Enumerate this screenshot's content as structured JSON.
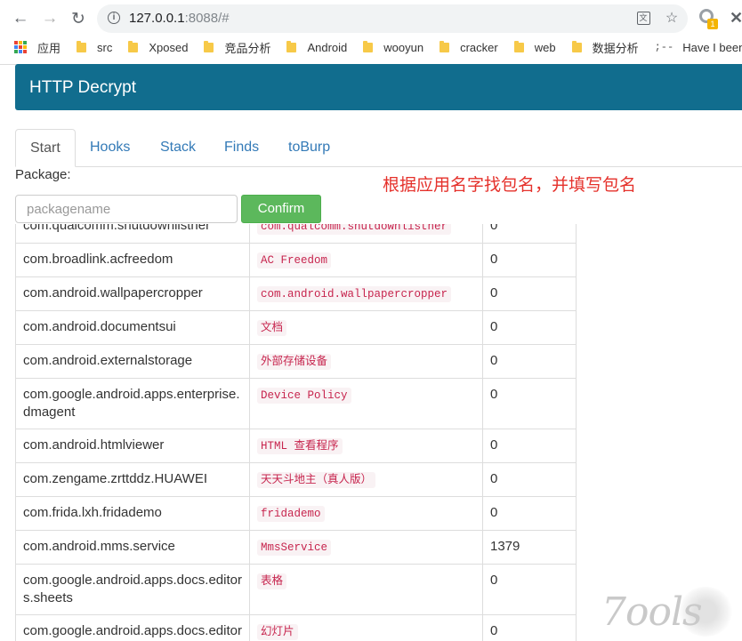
{
  "browser": {
    "url_host": "127.0.0.1",
    "url_rest": ":8088/#",
    "bookmarks": [
      {
        "label": "应用",
        "icon": "apps-grid-icon"
      },
      {
        "label": "src",
        "icon": "folder-icon"
      },
      {
        "label": "Xposed",
        "icon": "folder-icon"
      },
      {
        "label": "竞品分析",
        "icon": "folder-icon"
      },
      {
        "label": "Android",
        "icon": "folder-icon"
      },
      {
        "label": "wooyun",
        "icon": "folder-icon"
      },
      {
        "label": "cracker",
        "icon": "folder-icon"
      },
      {
        "label": "web",
        "icon": "folder-icon"
      },
      {
        "label": "数据分析",
        "icon": "folder-icon"
      },
      {
        "label": "Have I been pwn",
        "icon": "hibp-icon",
        "prefix": ";--"
      }
    ],
    "extension_badge": "1"
  },
  "app": {
    "brand": "HTTP Decrypt",
    "tabs": [
      "Start",
      "Hooks",
      "Stack",
      "Finds",
      "toBurp"
    ],
    "active_tab": "Start",
    "package_label": "Package:",
    "annotation": "根据应用名字找包名，并填写包名",
    "input_placeholder": "packagename",
    "input_value": "",
    "confirm_label": "Confirm",
    "watermark": "7ools"
  },
  "rows": [
    {
      "package": "com.qualcomm.shutdownlistner",
      "name": "com.qualcomm.shutdownlistner",
      "value": "0"
    },
    {
      "package": "com.broadlink.acfreedom",
      "name": "AC Freedom",
      "value": "0"
    },
    {
      "package": "com.android.wallpapercropper",
      "name": "com.android.wallpapercropper",
      "value": "0"
    },
    {
      "package": "com.android.documentsui",
      "name": "文档",
      "value": "0"
    },
    {
      "package": "com.android.externalstorage",
      "name": "外部存储设备",
      "value": "0"
    },
    {
      "package": "com.google.android.apps.enterprise.dmagent",
      "name": "Device Policy",
      "value": "0"
    },
    {
      "package": "com.android.htmlviewer",
      "name": "HTML 查看程序",
      "value": "0"
    },
    {
      "package": "com.zengame.zrttddz.HUAWEI",
      "name": "天天斗地主（真人版）",
      "value": "0"
    },
    {
      "package": "com.frida.lxh.fridademo",
      "name": "fridademo",
      "value": "0"
    },
    {
      "package": "com.android.mms.service",
      "name": "MmsService",
      "value": "1379"
    },
    {
      "package": "com.google.android.apps.docs.editors.sheets",
      "name": "表格",
      "value": "0"
    },
    {
      "package": "com.google.android.apps.docs.editors.slides",
      "name": "幻灯片",
      "value": "0"
    }
  ]
}
